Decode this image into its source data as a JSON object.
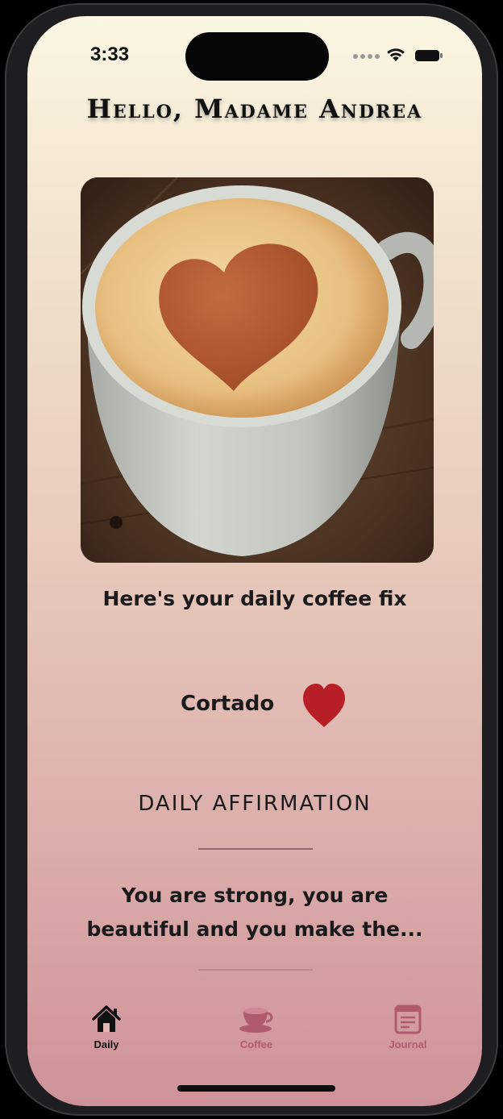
{
  "status_bar": {
    "time": "3:33"
  },
  "header": {
    "greeting": "Hello, Madame Andrea"
  },
  "coffee_image": {
    "subject": "latte-art-heart-cup"
  },
  "daily": {
    "subtitle": "Here's your daily coffee fix",
    "coffee_name": "Cortado",
    "favorite_icon": "heart-icon",
    "favorite_color": "#b81e25",
    "favorited": true
  },
  "affirmation": {
    "title": "DAILY AFFIRMATION",
    "text": "You are strong, you are beautiful and you make the..."
  },
  "tab_bar": {
    "tabs": [
      {
        "label": "Daily",
        "icon": "house-icon",
        "active": true
      },
      {
        "label": "Coffee",
        "icon": "coffee-cup-icon",
        "active": false
      },
      {
        "label": "Journal",
        "icon": "journal-icon",
        "active": false
      }
    ],
    "active_color": "#111111",
    "inactive_color": "#b05a6e"
  }
}
